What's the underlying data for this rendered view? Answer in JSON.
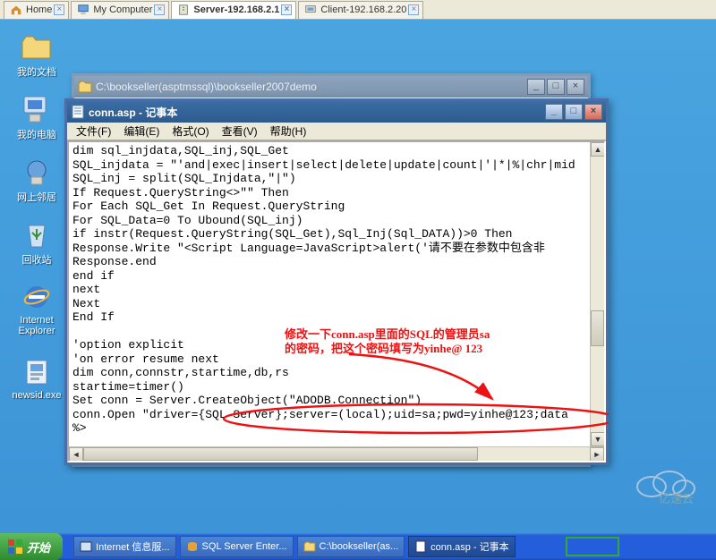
{
  "vm_tabs": [
    {
      "label": "Home",
      "icon": "home-icon",
      "active": false
    },
    {
      "label": "My Computer",
      "icon": "pc-icon",
      "active": false
    },
    {
      "label": "Server-192.168.2.1",
      "icon": "server-icon",
      "active": true
    },
    {
      "label": "Client-192.168.2.20",
      "icon": "client-icon",
      "active": false
    }
  ],
  "desktop_icons": {
    "mydocs": {
      "label": "我的文档"
    },
    "mycomp": {
      "label": "我的电脑"
    },
    "network": {
      "label": "网上邻居"
    },
    "recycle": {
      "label": "回收站"
    },
    "ie": {
      "label": "Internet Explorer"
    },
    "newsid": {
      "label": "newsid.exe"
    }
  },
  "explorer_window": {
    "title": "C:\\bookseller(asptmssql)\\bookseller2007demo"
  },
  "notepad_window": {
    "title": "conn.asp - 记事本",
    "menus": {
      "file": "文件(F)",
      "edit": "编辑(E)",
      "format": "格式(O)",
      "view": "查看(V)",
      "help": "帮助(H)"
    },
    "content_lines": [
      "dim sql_injdata,SQL_inj,SQL_Get",
      "SQL_injdata = \"'and|exec|insert|select|delete|update|count|'|*|%|chr|mid",
      "SQL_inj = split(SQL_Injdata,\"|\")",
      "If Request.QueryString<>\"\" Then",
      "For Each SQL_Get In Request.QueryString",
      "For SQL_Data=0 To Ubound(SQL_inj)",
      "if instr(Request.QueryString(SQL_Get),Sql_Inj(Sql_DATA))>0 Then",
      "Response.Write \"<Script Language=JavaScript>alert('请不要在参数中包含非",
      "Response.end",
      "end if",
      "next",
      "Next",
      "End If",
      "",
      "'option explicit",
      "'on error resume next",
      "dim conn,connstr,startime,db,rs",
      "startime=timer()",
      "Set conn = Server.CreateObject(\"ADODB.Connection\")",
      "conn.Open \"driver={SQL Server};server=(local);uid=sa;pwd=yinhe@123;data",
      "%>"
    ]
  },
  "annotation": {
    "line1": "修改一下conn.asp里面的SQL的管理员sa",
    "line2": "的密码，把这个密码填写为yinhe@ 123"
  },
  "taskbar": {
    "start": "开始",
    "buttons": [
      {
        "label": "Internet 信息服..."
      },
      {
        "label": "SQL Server Enter..."
      },
      {
        "label": "C:\\bookseller(as..."
      },
      {
        "label": "conn.asp - 记事本",
        "active": true
      }
    ]
  },
  "watermark": "亿速云"
}
